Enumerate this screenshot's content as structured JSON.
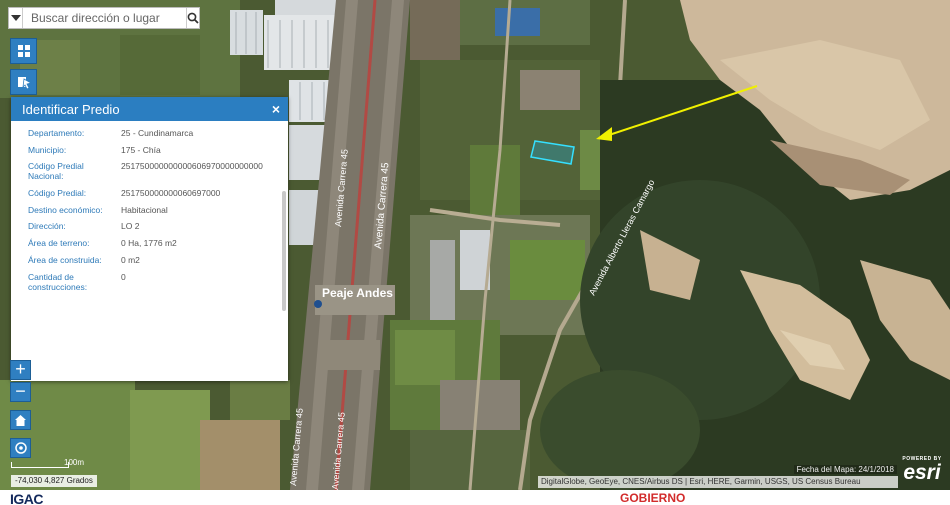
{
  "search": {
    "placeholder": "Buscar dirección o lugar"
  },
  "panel": {
    "title": "Identificar Predio",
    "close_label": "×",
    "rows": [
      {
        "label": "Departamento:",
        "value": "25 - Cundinamarca"
      },
      {
        "label": "Municipio:",
        "value": "175 - Chía"
      },
      {
        "label": "Código Predial Nacional:",
        "value": "251750000000000606970000000000"
      },
      {
        "label": "Código Predial:",
        "value": "251750000000060697000"
      },
      {
        "label": "Destino económico:",
        "value": "Habitacional"
      },
      {
        "label": "Dirección:",
        "value": "LO 2"
      },
      {
        "label": "Área de terreno:",
        "value": "0 Ha, 1776 m2"
      },
      {
        "label": "Área de construida:",
        "value": "0 m2"
      },
      {
        "label": "Cantidad de construcciones:",
        "value": "0"
      }
    ]
  },
  "map_labels": {
    "road1": "Avenida Carrera 45",
    "road2": "Avenida Carrera 45",
    "road3": "Avenida Carrera 45",
    "road4": "Avenida Carrera 45",
    "road5": "Avenida Alberto Lleras Camargo",
    "toll": "Peaje Andes"
  },
  "zoom": {
    "in": "+",
    "out": "−"
  },
  "scale": {
    "label": "100m"
  },
  "coordinates": "-74,030 4,827 Grados",
  "map_date": "Fecha del Mapa: 24/1/2018",
  "attribution": "DigitalGlobe, GeoEye, CNES/Airbus DS | Esri, HERE, Garmin, USGS, US Census Bureau",
  "esri": {
    "powered": "POWERED BY",
    "word": "esri"
  },
  "footer": {
    "left": "IGAC",
    "right": "GOBIERNO"
  },
  "colors": {
    "accent": "#2b7ec1",
    "parcel": "#35e0ff",
    "arrow": "#f0f000"
  }
}
